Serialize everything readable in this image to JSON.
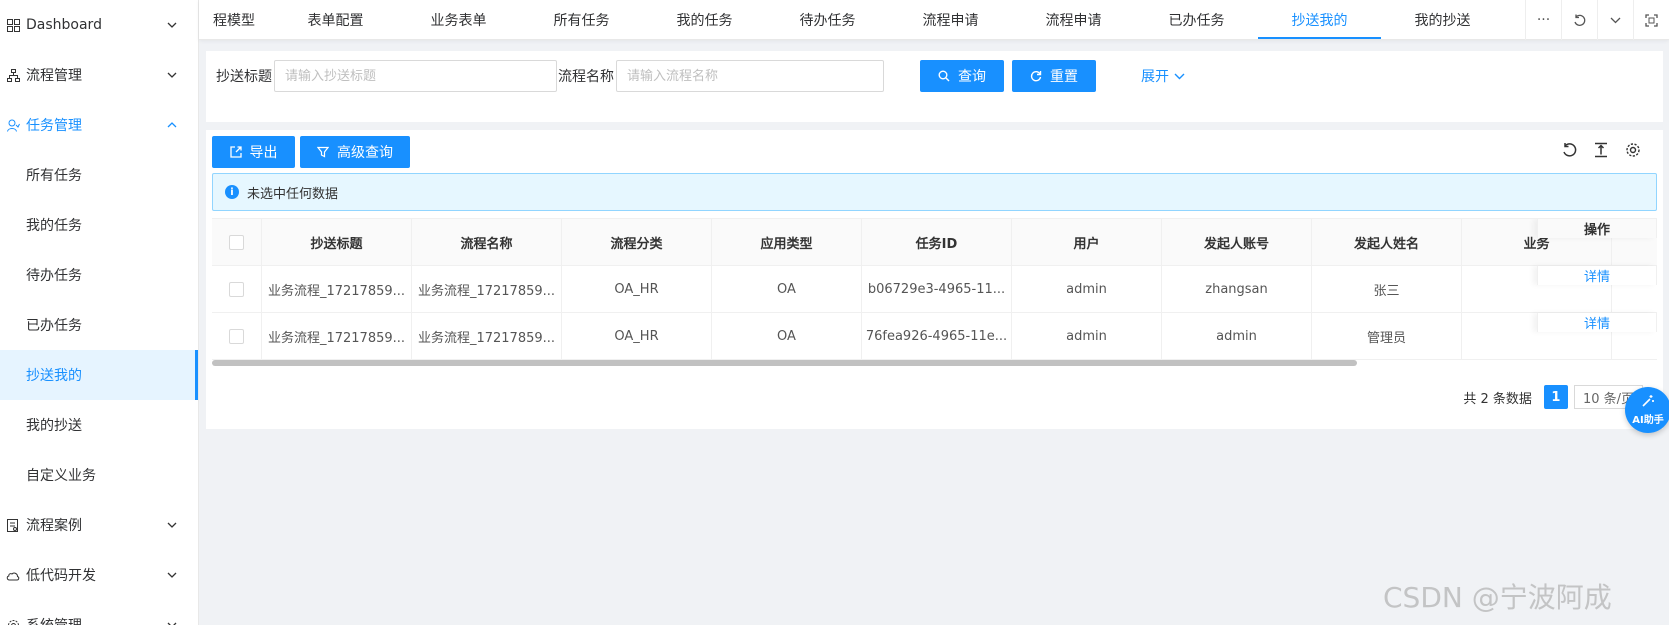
{
  "sidebar": {
    "items": [
      {
        "label": "Dashboard"
      },
      {
        "label": "流程管理"
      },
      {
        "label": "任务管理"
      },
      {
        "label": "流程案例"
      },
      {
        "label": "低代码开发"
      },
      {
        "label": "系统管理"
      }
    ],
    "sub_items": [
      {
        "label": "所有任务"
      },
      {
        "label": "我的任务"
      },
      {
        "label": "待办任务"
      },
      {
        "label": "已办任务"
      },
      {
        "label": "抄送我的"
      },
      {
        "label": "我的抄送"
      },
      {
        "label": "自定义业务"
      }
    ]
  },
  "tabs": [
    {
      "label": "程模型"
    },
    {
      "label": "表单配置"
    },
    {
      "label": "业务表单"
    },
    {
      "label": "所有任务"
    },
    {
      "label": "我的任务"
    },
    {
      "label": "待办任务"
    },
    {
      "label": "流程申请"
    },
    {
      "label": "流程申请"
    },
    {
      "label": "已办任务"
    },
    {
      "label": "抄送我的"
    },
    {
      "label": "我的抄送"
    }
  ],
  "tab_more": "···",
  "search": {
    "title_label": "抄送标题",
    "title_placeholder": "请输入抄送标题",
    "flow_label": "流程名称",
    "flow_placeholder": "请输入流程名称",
    "query_label": "查询",
    "reset_label": "重置",
    "expand_label": "展开"
  },
  "toolbar": {
    "export_label": "导出",
    "advanced_label": "高级查询"
  },
  "alert": {
    "text": "未选中任何数据"
  },
  "table": {
    "columns": [
      "抄送标题",
      "流程名称",
      "流程分类",
      "应用类型",
      "任务ID",
      "用户",
      "发起人账号",
      "发起人姓名",
      "业务",
      "操作"
    ],
    "rows": [
      {
        "title": "业务流程_17217859...",
        "flow": "业务流程_17217859...",
        "category": "OA_HR",
        "app": "OA",
        "task_id": "b06729e3-4965-11...",
        "user": "admin",
        "account": "zhangsan",
        "name": "张三",
        "biz": "",
        "op": "详情"
      },
      {
        "title": "业务流程_17217859...",
        "flow": "业务流程_17217859...",
        "category": "OA_HR",
        "app": "OA",
        "task_id": "76fea926-4965-11e...",
        "user": "admin",
        "account": "admin",
        "name": "管理员",
        "biz": "",
        "op": "详情"
      }
    ]
  },
  "pager": {
    "total_text": "共 2 条数据",
    "current_page": "1",
    "page_size": "10 条/页"
  },
  "ai_assistant": "AI助手",
  "watermark": "CSDN @宁波阿成",
  "colors": {
    "primary": "#1890ff"
  }
}
